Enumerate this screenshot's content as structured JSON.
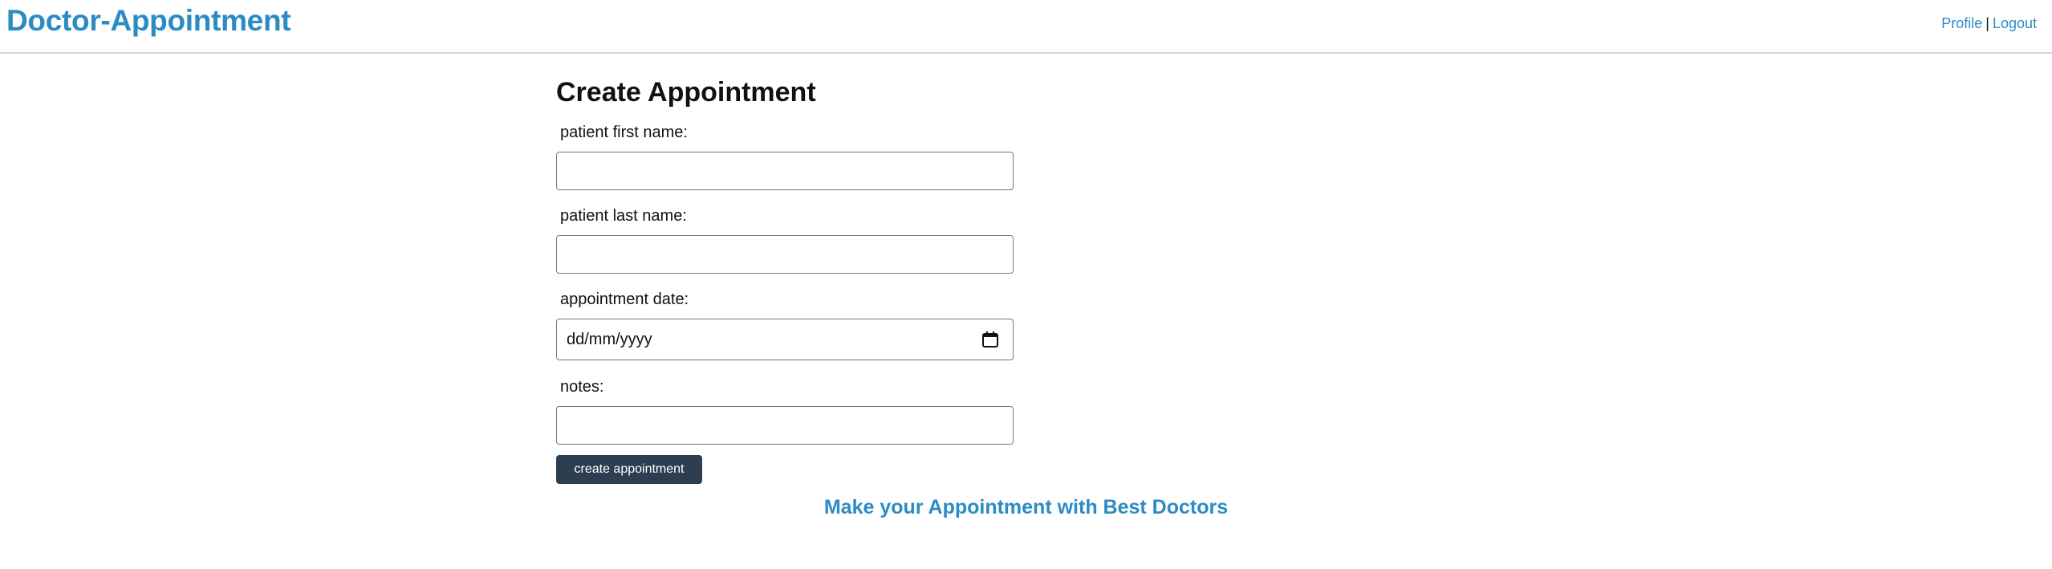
{
  "header": {
    "brand": "Doctor-Appointment",
    "nav": {
      "profile": "Profile",
      "separator": "|",
      "logout": "Logout"
    }
  },
  "form": {
    "title": "Create Appointment",
    "fields": [
      {
        "label": "patient first name:",
        "value": ""
      },
      {
        "label": "patient last name:",
        "value": ""
      },
      {
        "label": "appointment date:",
        "placeholder": "dd/mm/yyyy"
      },
      {
        "label": "notes:",
        "value": ""
      }
    ],
    "submit_label": "create appointment"
  },
  "footer": {
    "tagline": "Make your Appointment with Best Doctors"
  },
  "colors": {
    "brand": "#2b8bc3",
    "button": "#2c3e50"
  },
  "icons": {
    "date_picker": "calendar-icon"
  }
}
